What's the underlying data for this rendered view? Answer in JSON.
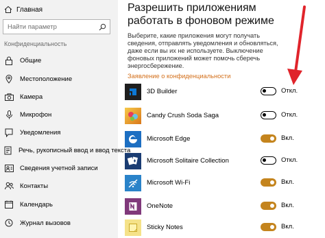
{
  "sidebar": {
    "home_label": "Главная",
    "search_placeholder": "Найти параметр",
    "section_title": "Конфиденциальность",
    "items": [
      {
        "label": "Общие",
        "icon": "lock-icon"
      },
      {
        "label": "Местоположение",
        "icon": "location-icon"
      },
      {
        "label": "Камера",
        "icon": "camera-icon"
      },
      {
        "label": "Микрофон",
        "icon": "microphone-icon"
      },
      {
        "label": "Уведомления",
        "icon": "notifications-icon"
      },
      {
        "label": "Речь, рукописный ввод и ввод текста",
        "icon": "speech-icon"
      },
      {
        "label": "Сведения учетной записи",
        "icon": "account-icon"
      },
      {
        "label": "Контакты",
        "icon": "contacts-icon"
      },
      {
        "label": "Календарь",
        "icon": "calendar-icon"
      },
      {
        "label": "Журнал вызовов",
        "icon": "call-history-icon"
      }
    ]
  },
  "main": {
    "title": "Разрешить приложениям работать в фоновом режиме",
    "description": "Выберите, какие приложения могут получать сведения, отправлять уведомления и обновляться, даже если вы их не используете. Выключение фоновых приложений может помочь сберечь энергосбережение.",
    "privacy_link": "Заявление о конфиденциальности",
    "apps": [
      {
        "name": "3D Builder",
        "state": "Откл.",
        "on": false,
        "color": "#1f1f1f",
        "icon": "3d-builder-icon"
      },
      {
        "name": "Candy Crush Soda Saga",
        "state": "Откл.",
        "on": false,
        "color": "#e9a21c",
        "icon": "candy-crush-icon"
      },
      {
        "name": "Microsoft Edge",
        "state": "Вкл.",
        "on": true,
        "color": "#1d6fc2",
        "icon": "edge-icon"
      },
      {
        "name": "Microsoft Solitaire Collection",
        "state": "Откл.",
        "on": false,
        "color": "#1b3d73",
        "icon": "solitaire-icon"
      },
      {
        "name": "Microsoft Wi-Fi",
        "state": "Вкл.",
        "on": true,
        "color": "#2a83c9",
        "icon": "wifi-icon"
      },
      {
        "name": "OneNote",
        "state": "Вкл.",
        "on": true,
        "color": "#80397b",
        "icon": "onenote-icon"
      },
      {
        "name": "Sticky Notes",
        "state": "Вкл.",
        "on": true,
        "color": "#f5e289",
        "icon": "sticky-notes-icon"
      }
    ]
  },
  "colors": {
    "accent": "#c4841d",
    "link": "#d36f1a",
    "arrow": "#e0242b"
  }
}
